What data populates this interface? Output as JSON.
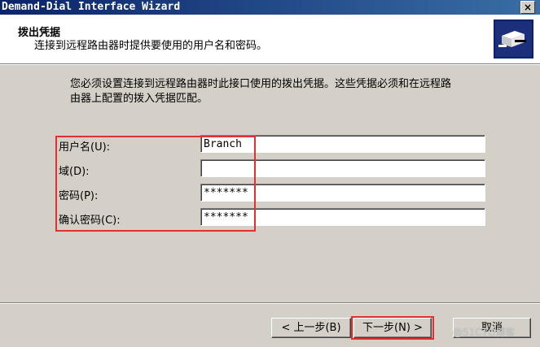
{
  "window": {
    "title": "Demand-Dial Interface Wizard",
    "close_glyph": "×"
  },
  "header": {
    "title": "拨出凭据",
    "subtitle": "连接到远程路由器时提供要使用的用户名和密码。"
  },
  "description": {
    "line1": "您必须设置连接到远程路由器时此接口使用的拨出凭据。这些凭据必须和在远程路",
    "line2": "由器上配置的拨入凭据匹配。"
  },
  "form": {
    "username": {
      "label": "用户名(U):",
      "value": "Branch"
    },
    "domain": {
      "label": "域(D):",
      "value": ""
    },
    "password": {
      "label": "密码(P):",
      "value": "*******"
    },
    "confirm_password": {
      "label": "确认密码(C):",
      "value": "*******"
    }
  },
  "buttons": {
    "back": "< 上一步(B)",
    "next": "下一步(N) >",
    "cancel": "取消"
  },
  "watermark": "@51CTO博客",
  "colors": {
    "highlight": "#e03030",
    "titlebar": "#0a246a",
    "dialog": "#d4d0c8"
  }
}
